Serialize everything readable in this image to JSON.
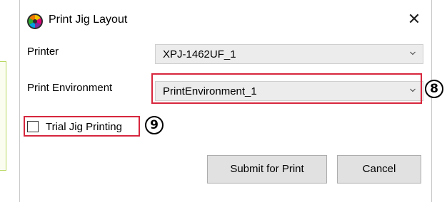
{
  "window": {
    "title": "Print Jig Layout",
    "close_glyph": "✕",
    "app_icon": "color-wheel-icon"
  },
  "form": {
    "printer_label": "Printer",
    "printer_value": "XPJ-1462UF_1",
    "env_label": "Print Environment",
    "env_value": "PrintEnvironment_1",
    "trial_label": "Trial Jig Printing",
    "trial_checked": false
  },
  "buttons": {
    "submit": "Submit for Print",
    "cancel": "Cancel"
  },
  "callouts": {
    "env_number": "8",
    "trial_number": "9"
  },
  "colors": {
    "callout": "#d7263d",
    "button_bg": "#e1e1e1",
    "combo_bg": "#ececec"
  }
}
